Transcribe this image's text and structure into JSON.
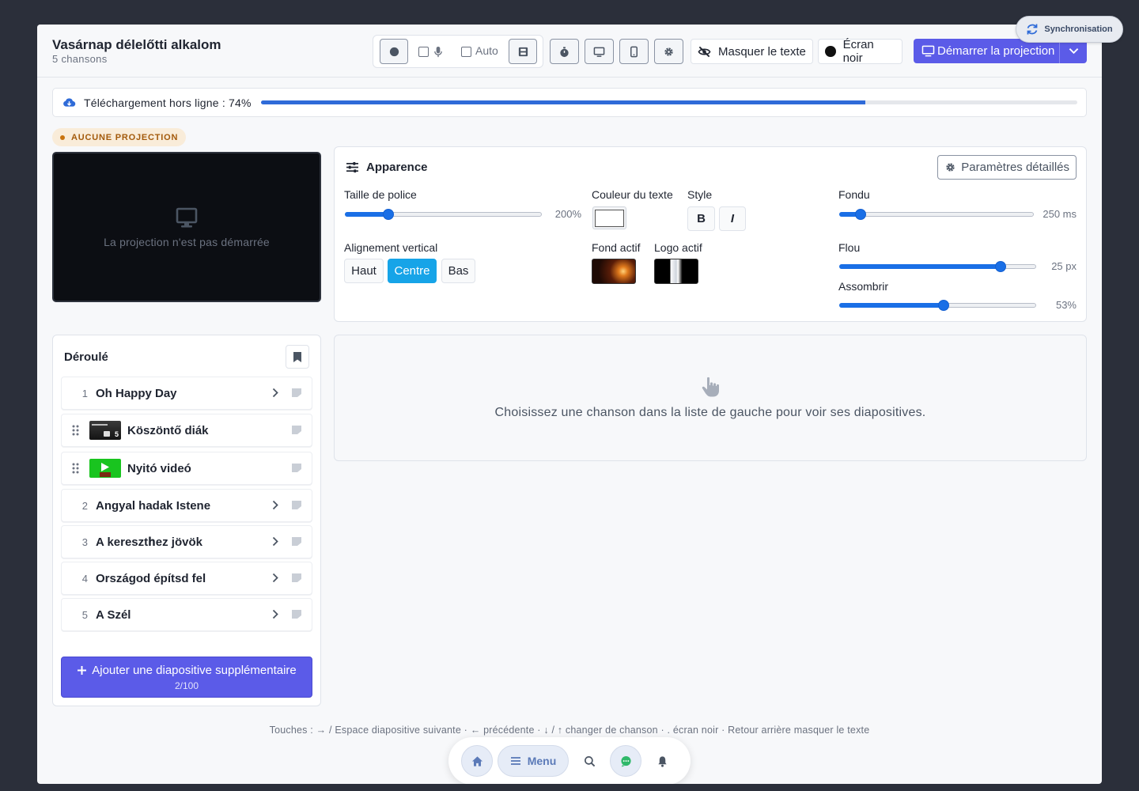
{
  "sync": {
    "label": "Synchronisation",
    "icon": "refresh-icon"
  },
  "header": {
    "title": "Vasárnap délelőtti alkalom",
    "subtitle": "5 chansons",
    "auto_label": "Auto",
    "hide_text_label": "Masquer le texte",
    "black_screen_label": "Écran noir",
    "start_projection_label": "Démarrer la projection"
  },
  "download": {
    "label": "Téléchargement hors ligne : 74%",
    "progress": 0.74
  },
  "status_badge": "AUCUNE PROJECTION",
  "preview": {
    "message": "La projection n'est pas démarrée"
  },
  "appearance": {
    "title": "Apparence",
    "detail_button": "Paramètres détaillés",
    "font_size": {
      "label": "Taille de police",
      "value": "200%",
      "level": 0.22
    },
    "text_color": {
      "label": "Couleur du texte",
      "color": "#ffffff"
    },
    "style": {
      "label": "Style",
      "bold": "B",
      "italic": "I"
    },
    "fade": {
      "label": "Fondu",
      "value": "250 ms",
      "level": 0.11
    },
    "vertical_align": {
      "label": "Alignement vertical",
      "options": [
        "Haut",
        "Centre",
        "Bas"
      ],
      "selected": "Centre"
    },
    "background": {
      "label": "Fond actif"
    },
    "logo": {
      "label": "Logo actif"
    },
    "blur": {
      "label": "Flou",
      "value": "25 px",
      "level": 0.82
    },
    "darken": {
      "label": "Assombrir",
      "value": "53%",
      "level": 0.53
    }
  },
  "runlist": {
    "title": "Déroulé",
    "items": [
      {
        "num": "1",
        "name": "Oh Happy Day",
        "kind": "song"
      },
      {
        "num": "",
        "name": "Köszöntő diák",
        "kind": "slides",
        "count": "5"
      },
      {
        "num": "",
        "name": "Nyitó videó",
        "kind": "video"
      },
      {
        "num": "2",
        "name": "Angyal hadak Istene",
        "kind": "song"
      },
      {
        "num": "3",
        "name": "A keresztհez jövök",
        "kind": "song"
      },
      {
        "num": "4",
        "name": "Országod építsd fel",
        "kind": "song"
      },
      {
        "num": "5",
        "name": "A Szél",
        "kind": "song"
      }
    ],
    "add_button": "Ajouter une diapositive supplémentaire",
    "add_count": "2/100"
  },
  "slides_panel": {
    "message": "Choisissez une chanson dans la liste de gauche pour voir ses diapositives."
  },
  "shortcuts": "Touches : → / Espace diapositive suivante · ← précédente · ↓ / ↑ changer de chanson · . écran noir · Retour arrière masquer le texte",
  "dock": {
    "menu_label": "Menu"
  },
  "colors": {
    "accent": "#5b5be8",
    "active": "#16a4e8",
    "slider": "#1a6fe6",
    "warning": "#c8730f"
  }
}
